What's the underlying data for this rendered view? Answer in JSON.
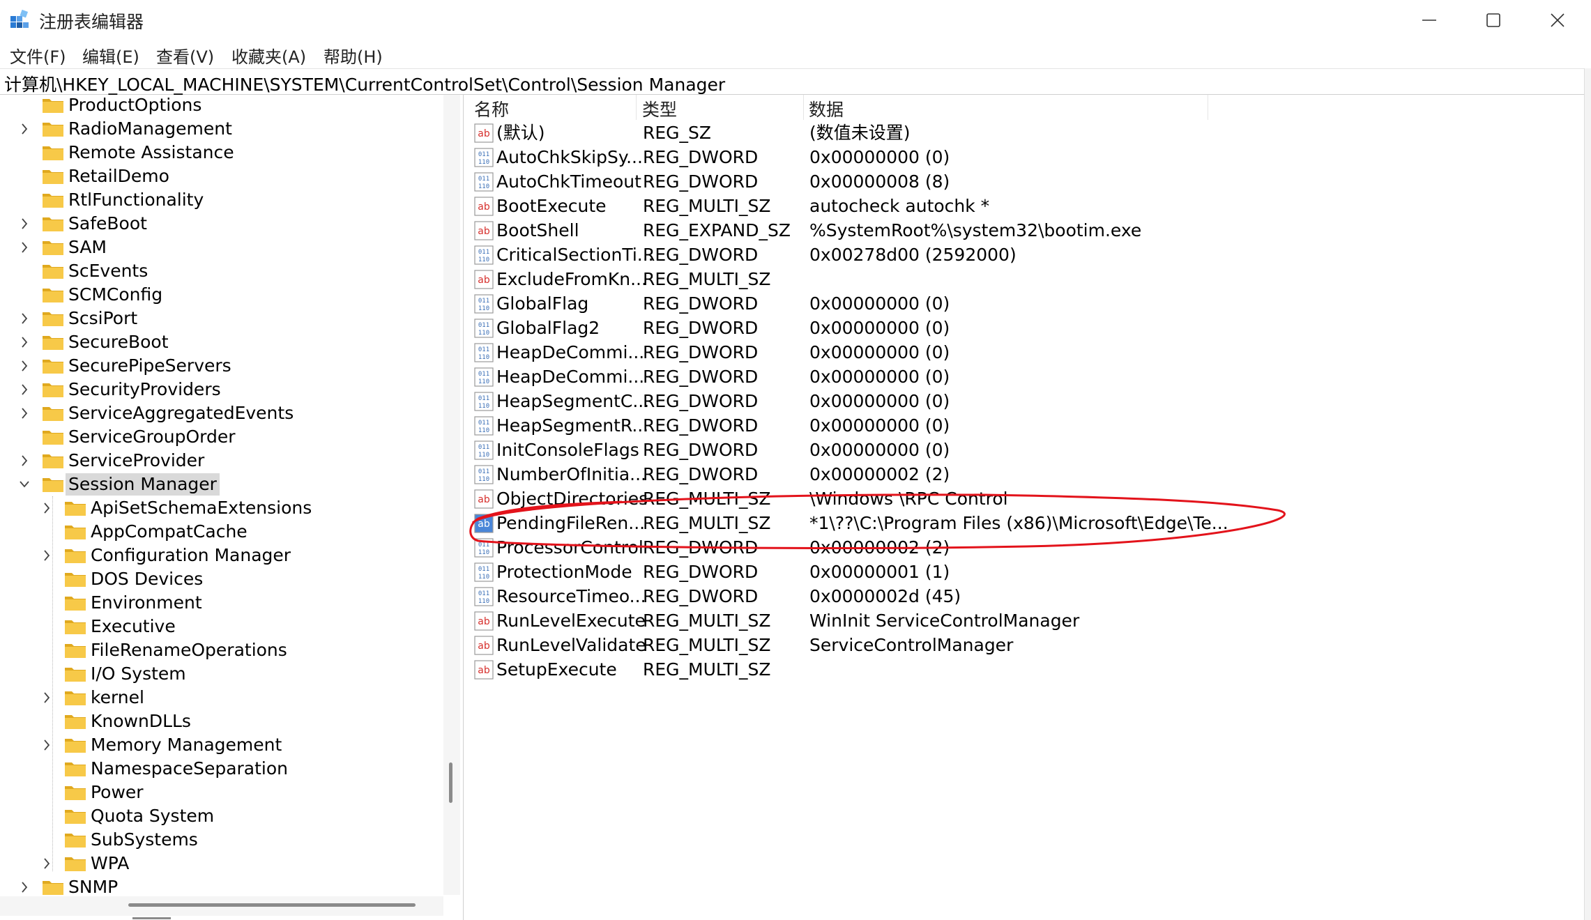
{
  "window": {
    "title": "注册表编辑器",
    "controls": {
      "minimize": "minimize",
      "maximize": "maximize",
      "close": "close"
    }
  },
  "menu": [
    "文件(F)",
    "编辑(E)",
    "查看(V)",
    "收藏夹(A)",
    "帮助(H)"
  ],
  "address": "计算机\\HKEY_LOCAL_MACHINE\\SYSTEM\\CurrentControlSet\\Control\\Session Manager",
  "colors": {
    "folder": "#f7c948",
    "folder_dark": "#e0a91f",
    "selection": "#d9d9d9",
    "annotation": "#e3131b",
    "binary_icon": "#3b6fb6",
    "string_icon": "#d6302d"
  },
  "tree": {
    "items": [
      {
        "label": "ProductOptions",
        "level": 1,
        "expander": "none"
      },
      {
        "label": "RadioManagement",
        "level": 1,
        "expander": "collapsed"
      },
      {
        "label": "Remote Assistance",
        "level": 1,
        "expander": "none"
      },
      {
        "label": "RetailDemo",
        "level": 1,
        "expander": "none"
      },
      {
        "label": "RtlFunctionality",
        "level": 1,
        "expander": "none"
      },
      {
        "label": "SafeBoot",
        "level": 1,
        "expander": "collapsed"
      },
      {
        "label": "SAM",
        "level": 1,
        "expander": "collapsed"
      },
      {
        "label": "ScEvents",
        "level": 1,
        "expander": "none"
      },
      {
        "label": "SCMConfig",
        "level": 1,
        "expander": "none"
      },
      {
        "label": "ScsiPort",
        "level": 1,
        "expander": "collapsed"
      },
      {
        "label": "SecureBoot",
        "level": 1,
        "expander": "collapsed"
      },
      {
        "label": "SecurePipeServers",
        "level": 1,
        "expander": "collapsed"
      },
      {
        "label": "SecurityProviders",
        "level": 1,
        "expander": "collapsed"
      },
      {
        "label": "ServiceAggregatedEvents",
        "level": 1,
        "expander": "collapsed"
      },
      {
        "label": "ServiceGroupOrder",
        "level": 1,
        "expander": "none"
      },
      {
        "label": "ServiceProvider",
        "level": 1,
        "expander": "collapsed"
      },
      {
        "label": "Session Manager",
        "level": 1,
        "expander": "expanded",
        "selected": true
      },
      {
        "label": "ApiSetSchemaExtensions",
        "level": 2,
        "expander": "collapsed"
      },
      {
        "label": "AppCompatCache",
        "level": 2,
        "expander": "none"
      },
      {
        "label": "Configuration Manager",
        "level": 2,
        "expander": "collapsed"
      },
      {
        "label": "DOS Devices",
        "level": 2,
        "expander": "none"
      },
      {
        "label": "Environment",
        "level": 2,
        "expander": "none"
      },
      {
        "label": "Executive",
        "level": 2,
        "expander": "none"
      },
      {
        "label": "FileRenameOperations",
        "level": 2,
        "expander": "none"
      },
      {
        "label": "I/O System",
        "level": 2,
        "expander": "none"
      },
      {
        "label": "kernel",
        "level": 2,
        "expander": "collapsed"
      },
      {
        "label": "KnownDLLs",
        "level": 2,
        "expander": "none"
      },
      {
        "label": "Memory Management",
        "level": 2,
        "expander": "collapsed"
      },
      {
        "label": "NamespaceSeparation",
        "level": 2,
        "expander": "none"
      },
      {
        "label": "Power",
        "level": 2,
        "expander": "none"
      },
      {
        "label": "Quota System",
        "level": 2,
        "expander": "none"
      },
      {
        "label": "SubSystems",
        "level": 2,
        "expander": "none"
      },
      {
        "label": "WPA",
        "level": 2,
        "expander": "collapsed"
      },
      {
        "label": "SNMP",
        "level": 1,
        "expander": "collapsed"
      }
    ]
  },
  "list": {
    "columns": [
      "名称",
      "类型",
      "数据"
    ],
    "rows": [
      {
        "icon": "string",
        "name": "(默认)",
        "type": "REG_SZ",
        "data": "(数值未设置)"
      },
      {
        "icon": "binary",
        "name": "AutoChkSkipSy...",
        "type": "REG_DWORD",
        "data": "0x00000000 (0)"
      },
      {
        "icon": "binary",
        "name": "AutoChkTimeout",
        "type": "REG_DWORD",
        "data": "0x00000008 (8)"
      },
      {
        "icon": "string",
        "name": "BootExecute",
        "type": "REG_MULTI_SZ",
        "data": "autocheck autochk *"
      },
      {
        "icon": "string",
        "name": "BootShell",
        "type": "REG_EXPAND_SZ",
        "data": "%SystemRoot%\\system32\\bootim.exe"
      },
      {
        "icon": "binary",
        "name": "CriticalSectionTi...",
        "type": "REG_DWORD",
        "data": "0x00278d00 (2592000)"
      },
      {
        "icon": "string",
        "name": "ExcludeFromKn...",
        "type": "REG_MULTI_SZ",
        "data": ""
      },
      {
        "icon": "binary",
        "name": "GlobalFlag",
        "type": "REG_DWORD",
        "data": "0x00000000 (0)"
      },
      {
        "icon": "binary",
        "name": "GlobalFlag2",
        "type": "REG_DWORD",
        "data": "0x00000000 (0)"
      },
      {
        "icon": "binary",
        "name": "HeapDeCommi...",
        "type": "REG_DWORD",
        "data": "0x00000000 (0)"
      },
      {
        "icon": "binary",
        "name": "HeapDeCommi...",
        "type": "REG_DWORD",
        "data": "0x00000000 (0)"
      },
      {
        "icon": "binary",
        "name": "HeapSegmentC...",
        "type": "REG_DWORD",
        "data": "0x00000000 (0)"
      },
      {
        "icon": "binary",
        "name": "HeapSegmentR...",
        "type": "REG_DWORD",
        "data": "0x00000000 (0)"
      },
      {
        "icon": "binary",
        "name": "InitConsoleFlags",
        "type": "REG_DWORD",
        "data": "0x00000000 (0)"
      },
      {
        "icon": "binary",
        "name": "NumberOfInitia...",
        "type": "REG_DWORD",
        "data": "0x00000002 (2)"
      },
      {
        "icon": "string",
        "name": "ObjectDirectories",
        "type": "REG_MULTI_SZ",
        "data": "\\Windows \\RPC Control"
      },
      {
        "icon": "string",
        "name": "PendingFileRen...",
        "type": "REG_MULTI_SZ",
        "data": "*1\\??\\C:\\Program Files (x86)\\Microsoft\\Edge\\Te...",
        "highlighted": true
      },
      {
        "icon": "binary",
        "name": "ProcessorControl",
        "type": "REG_DWORD",
        "data": "0x00000002 (2)"
      },
      {
        "icon": "binary",
        "name": "ProtectionMode",
        "type": "REG_DWORD",
        "data": "0x00000001 (1)"
      },
      {
        "icon": "binary",
        "name": "ResourceTimeo...",
        "type": "REG_DWORD",
        "data": "0x0000002d (45)"
      },
      {
        "icon": "string",
        "name": "RunLevelExecute",
        "type": "REG_MULTI_SZ",
        "data": "WinInit ServiceControlManager"
      },
      {
        "icon": "string",
        "name": "RunLevelValidate",
        "type": "REG_MULTI_SZ",
        "data": "ServiceControlManager"
      },
      {
        "icon": "string",
        "name": "SetupExecute",
        "type": "REG_MULTI_SZ",
        "data": ""
      }
    ]
  }
}
